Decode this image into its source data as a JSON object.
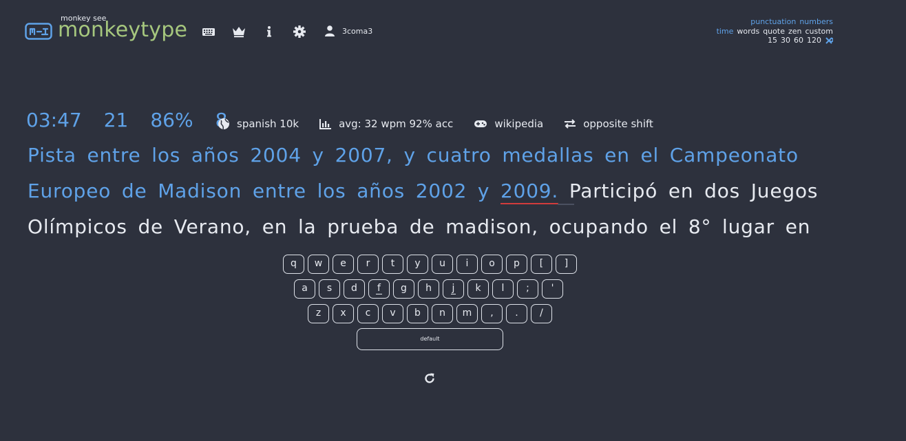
{
  "header": {
    "logo_small": "monkey see",
    "logo_text": "monkeytype",
    "username": "3coma3",
    "icons": [
      "keyboard-icon",
      "crown-icon",
      "info-icon",
      "gear-icon",
      "user-icon"
    ]
  },
  "config": {
    "row1": [
      "punctuation",
      "numbers"
    ],
    "row2": [
      "time",
      "words",
      "quote",
      "zen",
      "custom"
    ],
    "row3": [
      "15",
      "30",
      "60",
      "120"
    ],
    "active_mode": "time",
    "accent_color": "#5fa2e8"
  },
  "live_stats": {
    "timer": "03:47",
    "wpm": "21",
    "acc": "86%",
    "burst": "8"
  },
  "test_info": {
    "language": "spanish 10k",
    "average": "avg: 32 wpm 92% acc",
    "funbox": "wikipedia",
    "layout_mode": "opposite shift"
  },
  "words": {
    "typed": "Pista entre los años 2004 y 2007, y cuatro medallas en el Campeonato Europeo de Madison entre los años 2002 y",
    "current": "2009.",
    "pending": "Participó en dos Juegos Olímpicos de Verano, en la prueba de madison, ocupando el 8° lugar en"
  },
  "keyboard": {
    "row1": [
      "q",
      "w",
      "e",
      "r",
      "t",
      "y",
      "u",
      "i",
      "o",
      "p",
      "[",
      "]"
    ],
    "row2": [
      "a",
      "s",
      "d",
      "f",
      "g",
      "h",
      "j",
      "k",
      "l",
      ";",
      "'"
    ],
    "row3": [
      "z",
      "x",
      "c",
      "v",
      "b",
      "n",
      "m",
      ",",
      ".",
      "/"
    ],
    "space_label": "default"
  },
  "colors": {
    "background": "#2d313d",
    "main": "#5fa2e8",
    "logo": "#a6c77e",
    "error": "#d23c3c"
  }
}
